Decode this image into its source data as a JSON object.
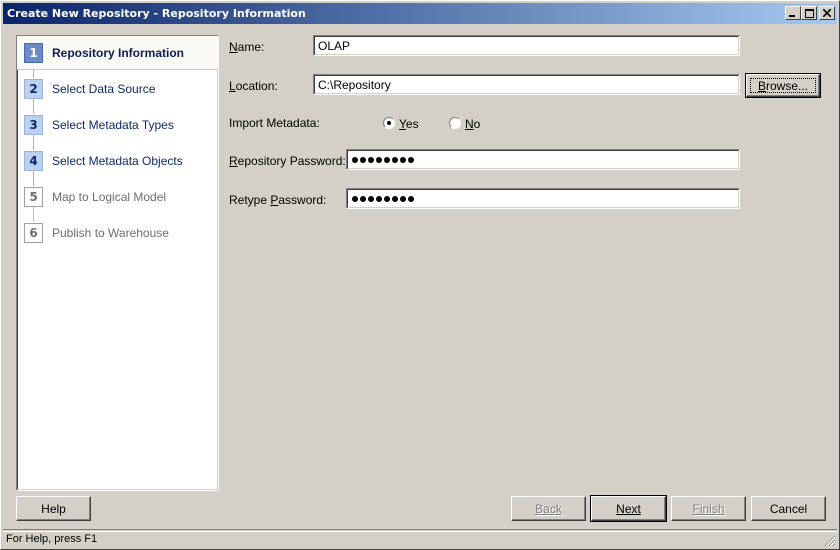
{
  "window": {
    "title": "Create New Repository - Repository Information",
    "controls": {
      "minimize": "minimize",
      "maximize": "maximize",
      "close": "close"
    }
  },
  "steps": [
    {
      "number": "1",
      "label": "Repository Information",
      "state": "current"
    },
    {
      "number": "2",
      "label": "Select Data Source",
      "state": "enabled"
    },
    {
      "number": "3",
      "label": "Select Metadata Types",
      "state": "enabled"
    },
    {
      "number": "4",
      "label": "Select Metadata Objects",
      "state": "enabled"
    },
    {
      "number": "5",
      "label": "Map to Logical Model",
      "state": "disabled"
    },
    {
      "number": "6",
      "label": "Publish to Warehouse",
      "state": "disabled"
    }
  ],
  "form": {
    "name": {
      "label_pre": "",
      "label_key": "N",
      "label_post": "ame:",
      "value": "OLAP"
    },
    "location": {
      "label_pre": "",
      "label_key": "L",
      "label_post": "ocation:",
      "value": "C:\\Repository",
      "browse_pre": "",
      "browse_key": "B",
      "browse_post": "rowse..."
    },
    "import_metadata": {
      "label": "Import Metadata:",
      "yes_key": "Y",
      "yes_post": "es",
      "no_key": "N",
      "no_post": "o",
      "selected": "Yes"
    },
    "repository_password": {
      "label_pre": "",
      "label_key": "R",
      "label_post": "epository Password:",
      "masked_length": 8
    },
    "retype_password": {
      "label_pre": "Retype ",
      "label_key": "P",
      "label_post": "assword:",
      "masked_length": 8
    }
  },
  "buttons": {
    "help": "Help",
    "back": "Back",
    "next": "Next",
    "finish": "Finish",
    "cancel": "Cancel"
  },
  "status": {
    "text": "For Help, press F1"
  }
}
